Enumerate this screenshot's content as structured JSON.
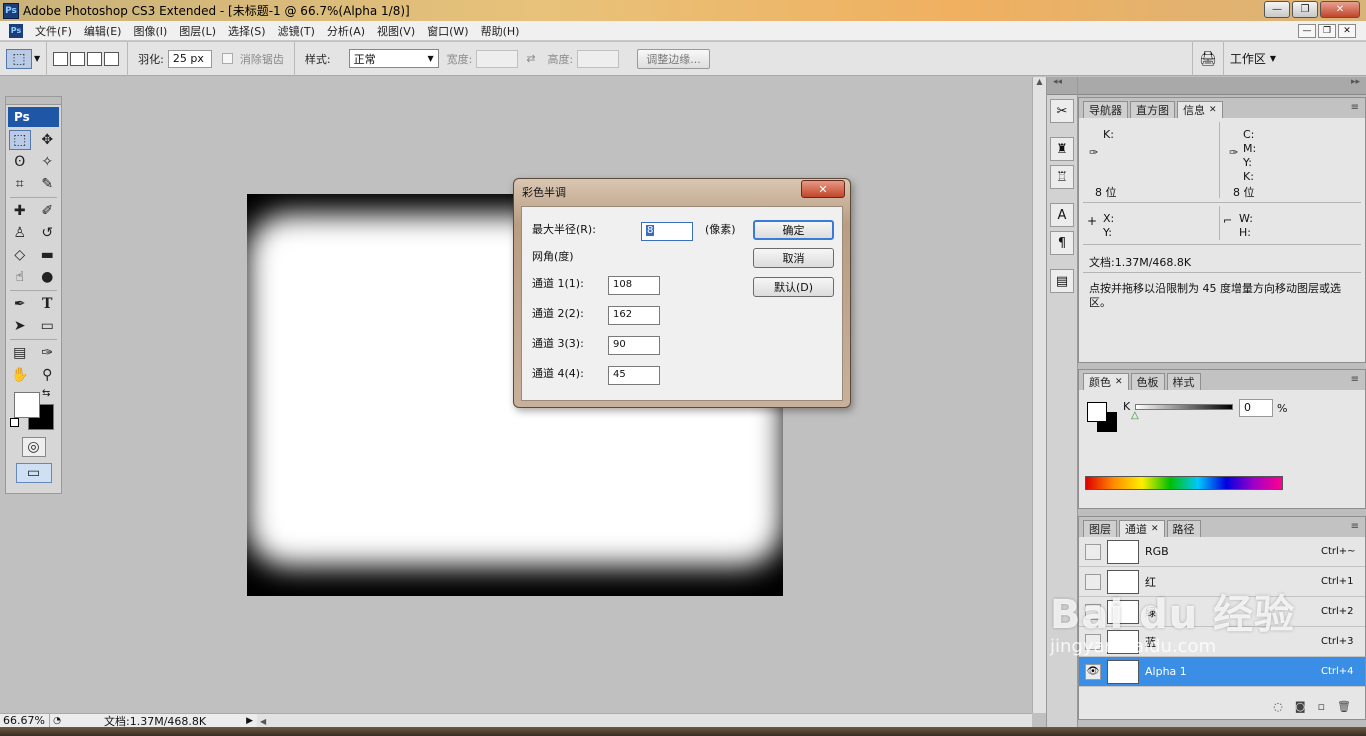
{
  "window": {
    "title": "Adobe Photoshop CS3 Extended - [未标题-1 @ 66.7%(Alpha 1/8)]",
    "controls": [
      "—",
      "❐",
      "✕"
    ]
  },
  "menubar": {
    "items": [
      "文件(F)",
      "编辑(E)",
      "图像(I)",
      "图层(L)",
      "选择(S)",
      "滤镜(T)",
      "分析(A)",
      "视图(V)",
      "窗口(W)",
      "帮助(H)"
    ],
    "doc_controls": [
      "—",
      "❐",
      "✕"
    ]
  },
  "options": {
    "feather_label": "羽化:",
    "feather_value": "25 px",
    "antialias_label": "消除锯齿",
    "style_label": "样式:",
    "style_value": "正常",
    "width_label": "宽度:",
    "height_label": "高度:",
    "refine_edge": "调整边缘...",
    "workspace": "工作区"
  },
  "toolbox": {
    "logo": "Ps"
  },
  "dialog": {
    "title": "彩色半调",
    "close": "✕",
    "max_radius_label": "最大半径(R):",
    "max_radius_value": "8",
    "max_radius_unit": "(像素)",
    "screen_angles_label": "网角(度)",
    "channel1_label": "通道 1(1):",
    "channel1_value": "108",
    "channel2_label": "通道 2(2):",
    "channel2_value": "162",
    "channel3_label": "通道 3(3):",
    "channel3_value": "90",
    "channel4_label": "通道 4(4):",
    "channel4_value": "45",
    "ok": "确定",
    "cancel": "取消",
    "default": "默认(D)"
  },
  "info_panel": {
    "tabs": [
      "导航器",
      "直方图",
      "信息"
    ],
    "k_label": "K:",
    "c_label": "C:",
    "m_label": "M:",
    "y_label": "Y:",
    "k2_label": "K:",
    "bits_left": "8 位",
    "bits_right": "8 位",
    "x_label": "X:",
    "y2_label": "Y:",
    "w_label": "W:",
    "h_label": "H:",
    "doc_size": "文档:1.37M/468.8K",
    "hint": "点按并拖移以沿限制为 45 度增量方向移动图层或选区。"
  },
  "color_panel": {
    "tabs": [
      "颜色",
      "色板",
      "样式"
    ],
    "channel_label": "K",
    "value": "0",
    "unit": "%"
  },
  "channels_panel": {
    "tabs": [
      "图层",
      "通道",
      "路径"
    ],
    "rows": [
      {
        "name": "RGB",
        "shortcut": "Ctrl+~"
      },
      {
        "name": "红",
        "shortcut": "Ctrl+1"
      },
      {
        "name": "绿",
        "shortcut": "Ctrl+2"
      },
      {
        "name": "蓝",
        "shortcut": "Ctrl+3"
      },
      {
        "name": "Alpha 1",
        "shortcut": "Ctrl+4"
      }
    ]
  },
  "status": {
    "zoom": "66.67%",
    "doc": "文档:1.37M/468.8K"
  },
  "watermark": {
    "brand": "Bai du 经验",
    "url": "jingyan.baidu.com"
  }
}
